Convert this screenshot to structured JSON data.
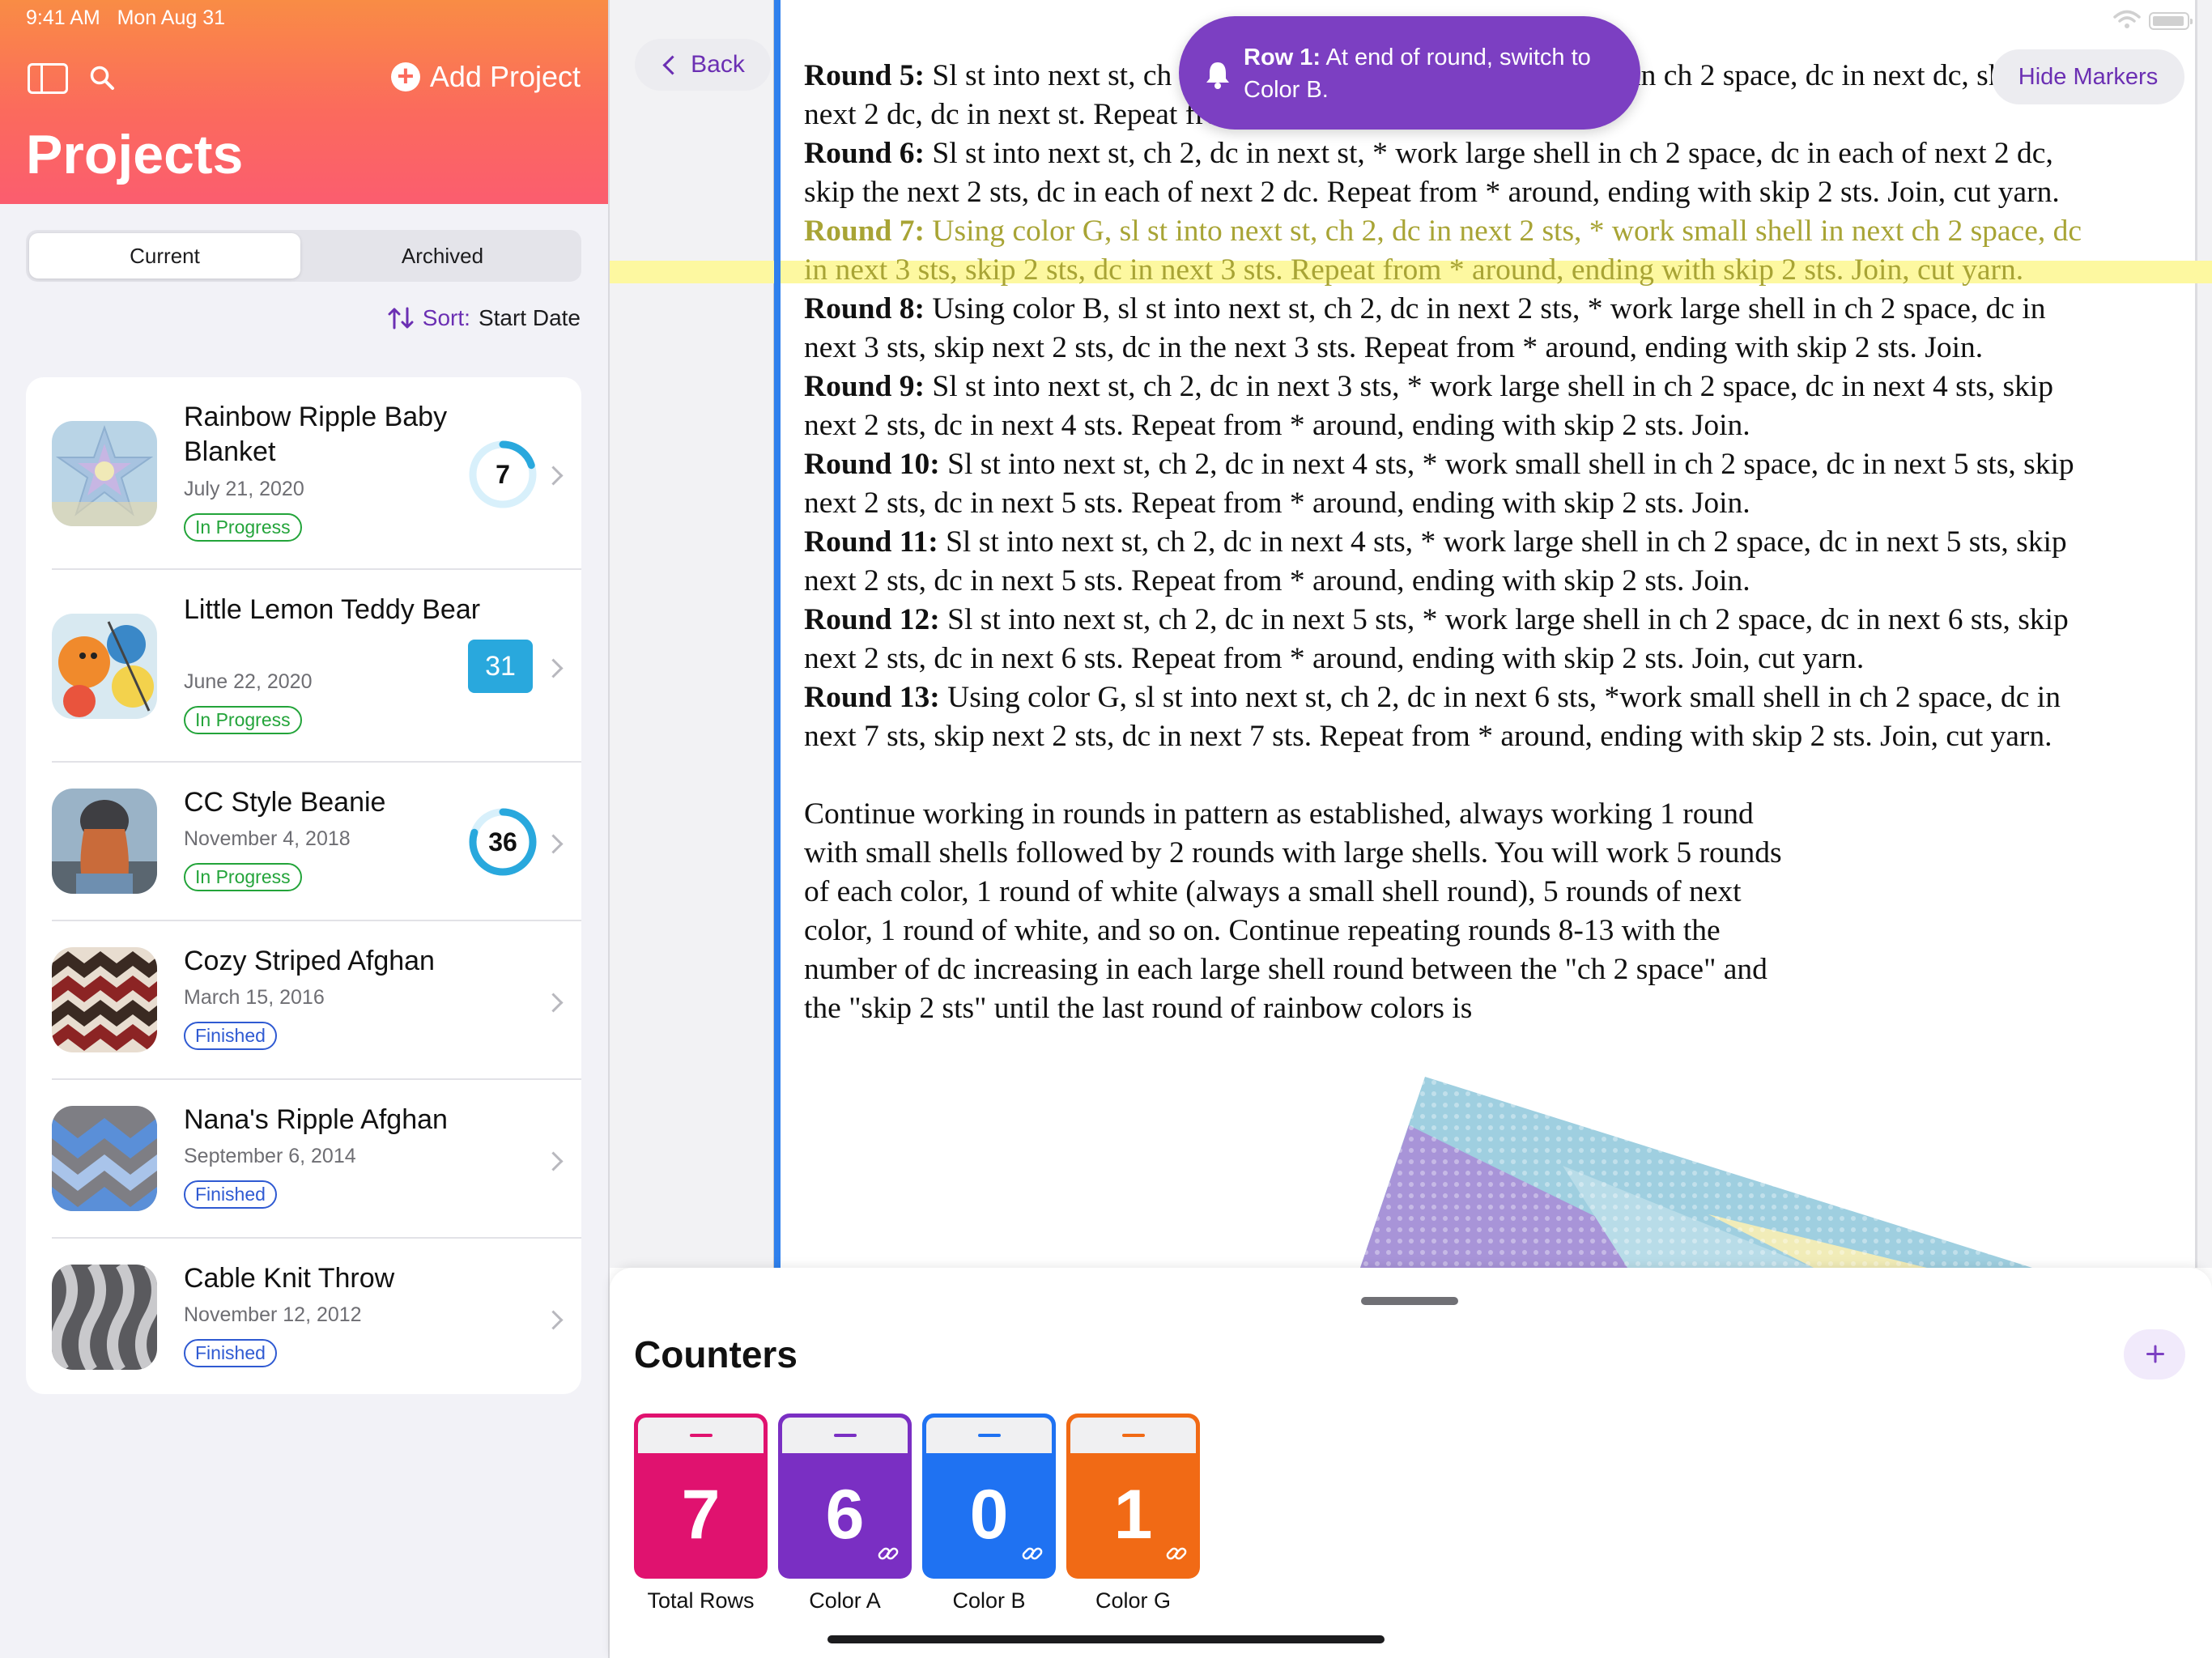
{
  "status": {
    "time": "9:41 AM",
    "date": "Mon Aug 31"
  },
  "sidebar": {
    "add_project_label": "Add Project",
    "title": "Projects",
    "segments": [
      "Current",
      "Archived"
    ],
    "sort_label": "Sort:",
    "sort_value": "Start Date",
    "projects": [
      {
        "title": "Rainbow Ripple Baby Blanket",
        "date": "July 21, 2020",
        "status": "In Progress",
        "count": "7",
        "count_style": "ring",
        "progress": 0.2
      },
      {
        "title": "Little Lemon Teddy Bear",
        "date": "June 22, 2020",
        "status": "In Progress",
        "count": "31",
        "count_style": "box"
      },
      {
        "title": "CC Style Beanie",
        "date": "November 4, 2018",
        "status": "In Progress",
        "count": "36",
        "count_style": "ring",
        "progress": 0.8
      },
      {
        "title": "Cozy Striped Afghan",
        "date": "March 15, 2016",
        "status": "Finished"
      },
      {
        "title": "Nana's Ripple Afghan",
        "date": "September 6, 2014",
        "status": "Finished"
      },
      {
        "title": "Cable Knit Throw",
        "date": "November 12, 2012",
        "status": "Finished"
      }
    ]
  },
  "main": {
    "back_label": "Back",
    "hide_markers_label": "Hide Markers",
    "toast": {
      "bold": "Row 1:",
      "text": " At end of round, switch to Color B."
    },
    "doc": {
      "lines": [
        {
          "label": "Round 5:",
          "text": " Sl st into next st, ch 2, dc in next 2 sts, * work large shell in ch 2 space, dc in next dc, skip next 2 dc, dc in next st. Repeat from * around. Join."
        },
        {
          "label": "Round 6:",
          "text": " Sl st into next st, ch 2, dc in next st, * work large shell in ch 2 space, dc in each of next 2 dc, skip the next 2 sts, dc in each of next 2 dc. Repeat from * around, ending with skip 2 sts. Join, cut yarn."
        },
        {
          "label": "Round 7:",
          "text": " Using color G, sl st into next st, ch 2, dc in next 2 sts, * work small shell in next ch 2 space, dc in next 3 sts, skip 2 sts, dc in next 3 sts. Repeat from * around, ending with skip 2 sts. Join, cut yarn.",
          "highlight": true
        },
        {
          "label": "Round 8:",
          "text": " Using color B, sl st into next st, ch 2, dc in next 2 sts, * work large shell in ch 2 space, dc in next 3 sts, skip next 2 sts, dc in the next 3 sts. Repeat from * around, ending with skip 2 sts. Join."
        },
        {
          "label": "Round 9:",
          "text": " Sl st into next st, ch 2, dc in next 3 sts, * work large shell in ch 2 space, dc in next 4 sts, skip next 2 sts, dc in next 4 sts. Repeat from * around, ending with skip 2 sts. Join."
        },
        {
          "label": "Round 10:",
          "text": " Sl st into next st, ch 2, dc in next 4 sts, * work small shell in ch 2 space, dc in next 5 sts, skip next 2 sts, dc in next 5 sts. Repeat from * around, ending with skip 2 sts. Join."
        },
        {
          "label": "Round 11:",
          "text": " Sl st into next st, ch 2, dc in next 4 sts, * work large shell in ch 2 space, dc in next 5 sts, skip next 2 sts, dc in next 5 sts. Repeat from * around, ending with skip 2 sts. Join."
        },
        {
          "label": "Round 12:",
          "text": " Sl st into next st, ch 2, dc in next 5 sts, * work large shell in ch 2 space, dc in next 6 sts, skip next 2 sts, dc in next 6 sts. Repeat from * around, ending with skip 2 sts. Join, cut yarn."
        },
        {
          "label": "Round 13:",
          "text": " Using color G, sl st into next st, ch 2, dc in next 6 sts, *work small shell in ch 2 space, dc in next 7 sts, skip next 2 sts, dc in next 7 sts. Repeat from * around, ending with skip 2 sts. Join, cut yarn."
        }
      ],
      "paragraph": "Continue working in rounds in pattern as established, always working 1 round with small shells followed by 2 rounds with large shells. You will work 5 rounds of each color, 1 round of white (always a small shell round), 5 rounds of next color, 1 round of white, and so on. Continue repeating rounds 8-13 with the number of dc increasing in each large shell round between the \"ch 2 space\" and the \"skip 2 sts\" until the last round of rainbow colors is"
    }
  },
  "counters": {
    "title": "Counters",
    "items": [
      {
        "value": "7",
        "label": "Total Rows",
        "color": "#e0126f",
        "linked": false
      },
      {
        "value": "6",
        "label": "Color A",
        "color": "#7a2fc3",
        "linked": true
      },
      {
        "value": "0",
        "label": "Color B",
        "color": "#1f72f2",
        "linked": true
      },
      {
        "value": "1",
        "label": "Color G",
        "color": "#f16a15",
        "linked": true
      }
    ]
  },
  "colors": {
    "accent": "#6b2fb3",
    "highlight": "#fdf8a0",
    "marker": "#2f80ed"
  }
}
